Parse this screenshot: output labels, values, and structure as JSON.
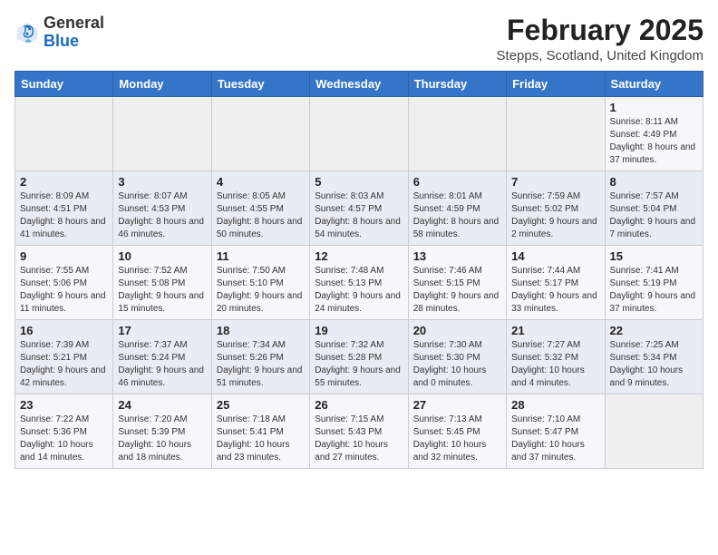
{
  "logo": {
    "general": "General",
    "blue": "Blue"
  },
  "header": {
    "title": "February 2025",
    "subtitle": "Stepps, Scotland, United Kingdom"
  },
  "weekdays": [
    "Sunday",
    "Monday",
    "Tuesday",
    "Wednesday",
    "Thursday",
    "Friday",
    "Saturday"
  ],
  "weeks": [
    [
      {
        "day": "",
        "info": ""
      },
      {
        "day": "",
        "info": ""
      },
      {
        "day": "",
        "info": ""
      },
      {
        "day": "",
        "info": ""
      },
      {
        "day": "",
        "info": ""
      },
      {
        "day": "",
        "info": ""
      },
      {
        "day": "1",
        "info": "Sunrise: 8:11 AM\nSunset: 4:49 PM\nDaylight: 8 hours and 37 minutes."
      }
    ],
    [
      {
        "day": "2",
        "info": "Sunrise: 8:09 AM\nSunset: 4:51 PM\nDaylight: 8 hours and 41 minutes."
      },
      {
        "day": "3",
        "info": "Sunrise: 8:07 AM\nSunset: 4:53 PM\nDaylight: 8 hours and 46 minutes."
      },
      {
        "day": "4",
        "info": "Sunrise: 8:05 AM\nSunset: 4:55 PM\nDaylight: 8 hours and 50 minutes."
      },
      {
        "day": "5",
        "info": "Sunrise: 8:03 AM\nSunset: 4:57 PM\nDaylight: 8 hours and 54 minutes."
      },
      {
        "day": "6",
        "info": "Sunrise: 8:01 AM\nSunset: 4:59 PM\nDaylight: 8 hours and 58 minutes."
      },
      {
        "day": "7",
        "info": "Sunrise: 7:59 AM\nSunset: 5:02 PM\nDaylight: 9 hours and 2 minutes."
      },
      {
        "day": "8",
        "info": "Sunrise: 7:57 AM\nSunset: 5:04 PM\nDaylight: 9 hours and 7 minutes."
      }
    ],
    [
      {
        "day": "9",
        "info": "Sunrise: 7:55 AM\nSunset: 5:06 PM\nDaylight: 9 hours and 11 minutes."
      },
      {
        "day": "10",
        "info": "Sunrise: 7:52 AM\nSunset: 5:08 PM\nDaylight: 9 hours and 15 minutes."
      },
      {
        "day": "11",
        "info": "Sunrise: 7:50 AM\nSunset: 5:10 PM\nDaylight: 9 hours and 20 minutes."
      },
      {
        "day": "12",
        "info": "Sunrise: 7:48 AM\nSunset: 5:13 PM\nDaylight: 9 hours and 24 minutes."
      },
      {
        "day": "13",
        "info": "Sunrise: 7:46 AM\nSunset: 5:15 PM\nDaylight: 9 hours and 28 minutes."
      },
      {
        "day": "14",
        "info": "Sunrise: 7:44 AM\nSunset: 5:17 PM\nDaylight: 9 hours and 33 minutes."
      },
      {
        "day": "15",
        "info": "Sunrise: 7:41 AM\nSunset: 5:19 PM\nDaylight: 9 hours and 37 minutes."
      }
    ],
    [
      {
        "day": "16",
        "info": "Sunrise: 7:39 AM\nSunset: 5:21 PM\nDaylight: 9 hours and 42 minutes."
      },
      {
        "day": "17",
        "info": "Sunrise: 7:37 AM\nSunset: 5:24 PM\nDaylight: 9 hours and 46 minutes."
      },
      {
        "day": "18",
        "info": "Sunrise: 7:34 AM\nSunset: 5:26 PM\nDaylight: 9 hours and 51 minutes."
      },
      {
        "day": "19",
        "info": "Sunrise: 7:32 AM\nSunset: 5:28 PM\nDaylight: 9 hours and 55 minutes."
      },
      {
        "day": "20",
        "info": "Sunrise: 7:30 AM\nSunset: 5:30 PM\nDaylight: 10 hours and 0 minutes."
      },
      {
        "day": "21",
        "info": "Sunrise: 7:27 AM\nSunset: 5:32 PM\nDaylight: 10 hours and 4 minutes."
      },
      {
        "day": "22",
        "info": "Sunrise: 7:25 AM\nSunset: 5:34 PM\nDaylight: 10 hours and 9 minutes."
      }
    ],
    [
      {
        "day": "23",
        "info": "Sunrise: 7:22 AM\nSunset: 5:36 PM\nDaylight: 10 hours and 14 minutes."
      },
      {
        "day": "24",
        "info": "Sunrise: 7:20 AM\nSunset: 5:39 PM\nDaylight: 10 hours and 18 minutes."
      },
      {
        "day": "25",
        "info": "Sunrise: 7:18 AM\nSunset: 5:41 PM\nDaylight: 10 hours and 23 minutes."
      },
      {
        "day": "26",
        "info": "Sunrise: 7:15 AM\nSunset: 5:43 PM\nDaylight: 10 hours and 27 minutes."
      },
      {
        "day": "27",
        "info": "Sunrise: 7:13 AM\nSunset: 5:45 PM\nDaylight: 10 hours and 32 minutes."
      },
      {
        "day": "28",
        "info": "Sunrise: 7:10 AM\nSunset: 5:47 PM\nDaylight: 10 hours and 37 minutes."
      },
      {
        "day": "",
        "info": ""
      }
    ]
  ]
}
